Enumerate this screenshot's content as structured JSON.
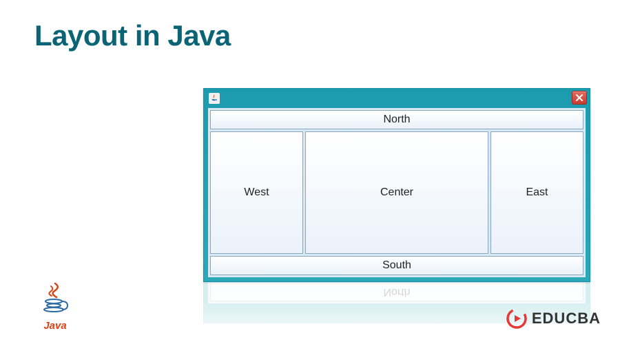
{
  "title": "Layout in Java",
  "window": {
    "regions": {
      "north": "North",
      "south": "South",
      "west": "West",
      "center": "Center",
      "east": "East"
    }
  },
  "logos": {
    "java_text": "Java",
    "educba_text": "EDUCBA"
  },
  "colors": {
    "title": "#0b6475",
    "window_chrome": "#2aa8b8",
    "close_btn": "#c83c2f",
    "java_red": "#d84315",
    "java_blue": "#2e6ca4",
    "educba_red": "#e53935"
  }
}
